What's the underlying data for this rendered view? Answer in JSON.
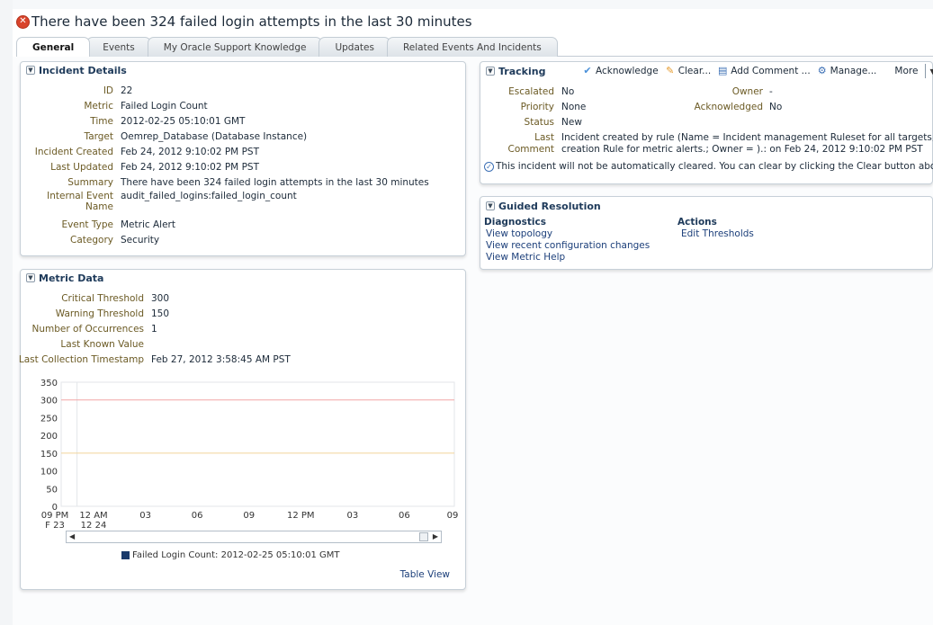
{
  "header": {
    "title": "There have been 324 failed login attempts in the last 30 minutes"
  },
  "tabs": [
    "General",
    "Events",
    "My Oracle Support Knowledge",
    "Updates",
    "Related Events And Incidents"
  ],
  "incident_details": {
    "title": "Incident Details",
    "rows": [
      {
        "label": "ID",
        "value": "22"
      },
      {
        "label": "Metric",
        "value": "Failed Login Count"
      },
      {
        "label": "Time",
        "value": "2012-02-25 05:10:01 GMT"
      },
      {
        "label": "Target",
        "value": "Oemrep_Database (Database Instance)"
      },
      {
        "label": "Incident Created",
        "value": "Feb 24, 2012 9:10:02 PM PST"
      },
      {
        "label": "Last Updated",
        "value": "Feb 24, 2012 9:10:02 PM PST"
      },
      {
        "label": "Summary",
        "value": "There have been 324 failed login attempts in the last 30 minutes"
      },
      {
        "label": "Internal Event Name",
        "label_line1": "Internal Event",
        "label_line2": "Name",
        "value": "audit_failed_logins:failed_login_count"
      },
      {
        "label": "Event Type",
        "value": "Metric Alert"
      },
      {
        "label": "Category",
        "value": "Security"
      }
    ]
  },
  "metric_data": {
    "title": "Metric Data",
    "rows": [
      {
        "label": "Critical Threshold",
        "value": "300"
      },
      {
        "label": "Warning Threshold",
        "value": "150"
      },
      {
        "label": "Number of Occurrences",
        "value": "1"
      },
      {
        "label": "Last Known Value",
        "value": ""
      },
      {
        "label": "Last Collection Timestamp",
        "value": "Feb 27, 2012 3:58:45 AM PST"
      }
    ],
    "table_view_label": "Table View"
  },
  "tracking": {
    "title": "Tracking",
    "toolbar": {
      "acknowledge": "Acknowledge",
      "clear": "Clear...",
      "add_comment": "Add Comment ...",
      "manage": "Manage...",
      "more": "More"
    },
    "escalated_label": "Escalated",
    "escalated_value": "No",
    "priority_label": "Priority",
    "priority_value": "None",
    "status_label": "Status",
    "status_value": "New",
    "owner_label": "Owner",
    "owner_value": "-",
    "acknowledged_label": "Acknowledged",
    "acknowledged_value": "No",
    "last_comment_label_1": "Last",
    "last_comment_label_2": "Comment",
    "last_comment_line1": "Incident created by rule (Name = Incident management Ruleset for all targets, Incident",
    "last_comment_line2": "creation Rule for metric alerts.; Owner = ).: on Feb 24, 2012 9:10:02 PM PST",
    "note": "This incident will not be automatically cleared. You can clear by clicking the Clear button above."
  },
  "guided_resolution": {
    "title": "Guided Resolution",
    "diagnostics_heading": "Diagnostics",
    "diagnostics": [
      "View topology",
      "View recent configuration changes",
      "View Metric Help"
    ],
    "actions_heading": "Actions",
    "actions": [
      "Edit Thresholds"
    ]
  },
  "colors": {
    "critical_line": "#f2a6a6",
    "warning_line": "#f0d49a",
    "series": "#1a3a6b",
    "error": "#d9442b"
  },
  "chart_data": {
    "type": "line",
    "title": "",
    "ylim": [
      0,
      350
    ],
    "yticks": [
      "0",
      "50",
      "100",
      "150",
      "200",
      "250",
      "300",
      "350"
    ],
    "xticks": [
      {
        "label": "09 PM",
        "sub": "F 23"
      },
      {
        "label": "12 AM",
        "sub": "12  24"
      },
      {
        "label": "03",
        "sub": ""
      },
      {
        "label": "06",
        "sub": ""
      },
      {
        "label": "09",
        "sub": ""
      },
      {
        "label": "12 PM",
        "sub": ""
      },
      {
        "label": "03",
        "sub": ""
      },
      {
        "label": "06",
        "sub": ""
      },
      {
        "label": "09",
        "sub": ""
      }
    ],
    "thresholds": [
      {
        "name": "Critical",
        "value": 300
      },
      {
        "name": "Warning",
        "value": 150
      }
    ],
    "series": [
      {
        "name": "Failed Login Count: 2012-02-25 05:10:01 GMT",
        "values": []
      }
    ],
    "grid": true,
    "legend": "bottom"
  }
}
